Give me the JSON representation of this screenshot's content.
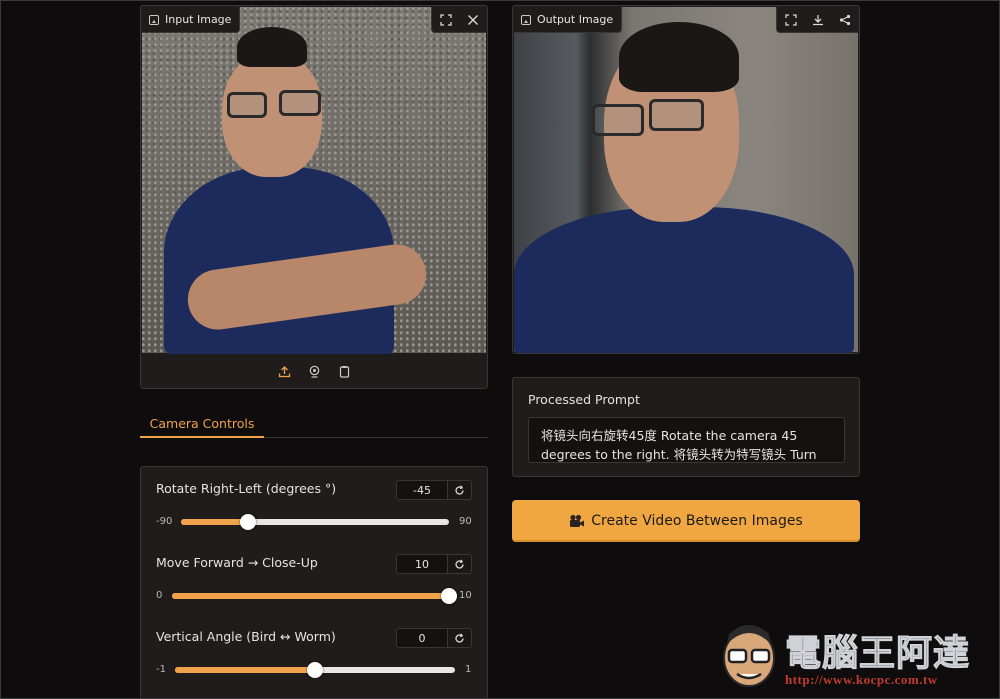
{
  "input_panel": {
    "label": "Input Image",
    "tools": [
      "fullscreen-icon",
      "close-icon"
    ],
    "bottom_tools": [
      "upload-icon",
      "webcam-icon",
      "clipboard-icon"
    ]
  },
  "output_panel": {
    "label": "Output Image",
    "tools": [
      "fullscreen-icon",
      "download-icon",
      "share-icon"
    ]
  },
  "tabs": [
    {
      "label": "Camera Controls",
      "active": true
    }
  ],
  "controls": [
    {
      "label": "Rotate Right-Left (degrees °)",
      "value": "-45",
      "min": "-90",
      "max": "90",
      "fraction": 0.25
    },
    {
      "label": "Move Forward → Close-Up",
      "value": "10",
      "min": "0",
      "max": "10",
      "fraction": 1.0
    },
    {
      "label": "Vertical Angle (Bird ↔ Worm)",
      "value": "0",
      "min": "-1",
      "max": "1",
      "fraction": 0.5
    }
  ],
  "prompt": {
    "title": "Processed Prompt",
    "text": "将镜头向右旋转45度 Rotate the camera 45 degrees to the right. 将镜头转为特写镜头 Turn the"
  },
  "create_button": {
    "icon": "video-camera-icon",
    "label": "Create Video Between Images"
  },
  "watermark": {
    "text": "電腦王阿達",
    "url": "http://www.kocpc.com.tw"
  },
  "colors": {
    "accent": "#f0a24a",
    "panel": "#1f1c1b",
    "background": "#0e0c0c"
  }
}
